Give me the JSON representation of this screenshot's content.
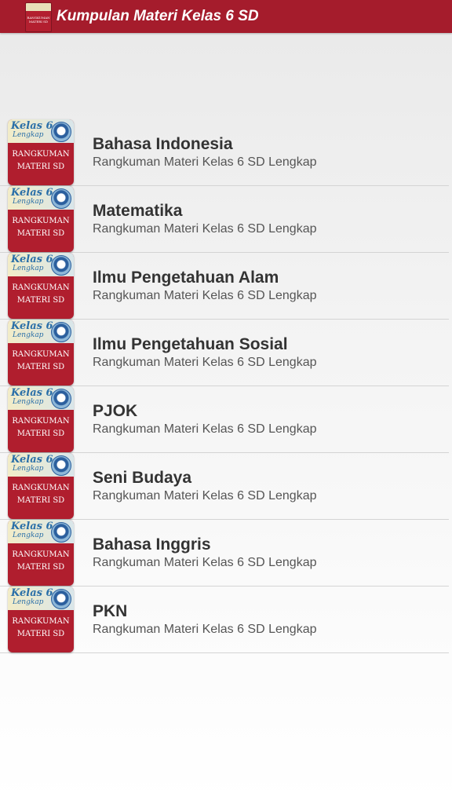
{
  "appbar": {
    "title": "Kumpulan Materi Kelas 6 SD",
    "logo_text": [
      "RANGKUMAN",
      "MATERI SD"
    ],
    "color": "#a51c2c"
  },
  "thumbnail": {
    "kelas": "Kelas 6",
    "lengkap": "Lengkap",
    "line1": "RANGKUMAN",
    "line2": "MATERI SD",
    "badge_icon": "school-emblem-icon",
    "color": "#b01e2e"
  },
  "items": [
    {
      "title": "Bahasa Indonesia",
      "subtitle": "Rangkuman Materi Kelas 6 SD Lengkap"
    },
    {
      "title": "Matematika",
      "subtitle": "Rangkuman Materi Kelas 6 SD Lengkap"
    },
    {
      "title": "Ilmu Pengetahuan Alam",
      "subtitle": "Rangkuman Materi Kelas 6 SD Lengkap"
    },
    {
      "title": "Ilmu Pengetahuan Sosial",
      "subtitle": "Rangkuman Materi Kelas 6 SD Lengkap"
    },
    {
      "title": "PJOK",
      "subtitle": "Rangkuman Materi Kelas 6 SD Lengkap"
    },
    {
      "title": "Seni Budaya",
      "subtitle": "Rangkuman Materi Kelas 6 SD Lengkap"
    },
    {
      "title": "Bahasa Inggris",
      "subtitle": "Rangkuman Materi Kelas 6 SD Lengkap"
    },
    {
      "title": "PKN",
      "subtitle": "Rangkuman Materi Kelas 6 SD Lengkap"
    }
  ]
}
